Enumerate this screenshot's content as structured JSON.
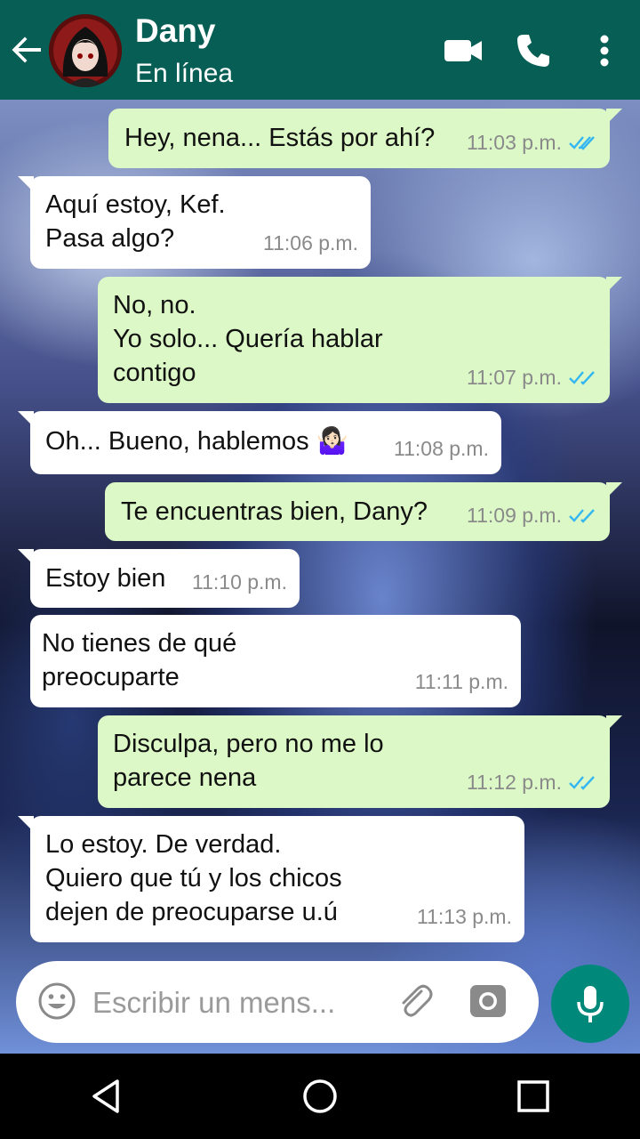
{
  "header": {
    "contact_name": "Dany",
    "status": "En línea",
    "icons": [
      "back-arrow-icon",
      "video-call-icon",
      "voice-call-icon",
      "more-options-icon"
    ]
  },
  "messages": [
    {
      "dir": "out",
      "text": "Hey, nena... Estás por ahí?",
      "time": "11:03 p.m.",
      "read": true
    },
    {
      "dir": "in",
      "text": "Aquí estoy, Kef.\nPasa algo?",
      "time": "11:06 p.m."
    },
    {
      "dir": "out",
      "text": "No, no.\nYo solo... Quería hablar\ncontigo",
      "time": "11:07 p.m.",
      "read": true
    },
    {
      "dir": "in",
      "text": "Oh... Bueno, hablemos 🤷🏻‍♀️",
      "time": "11:08 p.m."
    },
    {
      "dir": "out",
      "text": "Te encuentras bien, Dany?",
      "time": "11:09 p.m.",
      "read": true
    },
    {
      "dir": "in",
      "text": "Estoy bien",
      "time": "11:10 p.m."
    },
    {
      "dir": "in",
      "text": "No tienes de qué\npreocuparte",
      "time": "11:11 p.m."
    },
    {
      "dir": "out",
      "text": "Disculpa, pero no me lo\nparece nena",
      "time": "11:12 p.m.",
      "read": true
    },
    {
      "dir": "in",
      "text": "Lo estoy. De verdad.\nQuiero que tú y los chicos\ndejen de preocuparse u.ú",
      "time": "11:13 p.m."
    }
  ],
  "input": {
    "placeholder": "Escribir un mens..."
  },
  "colors": {
    "header": "#075E54",
    "outgoing_bubble": "#dcf8c6",
    "incoming_bubble": "#ffffff",
    "read_ticks": "#34B7F1",
    "mic_button": "#00897B"
  }
}
